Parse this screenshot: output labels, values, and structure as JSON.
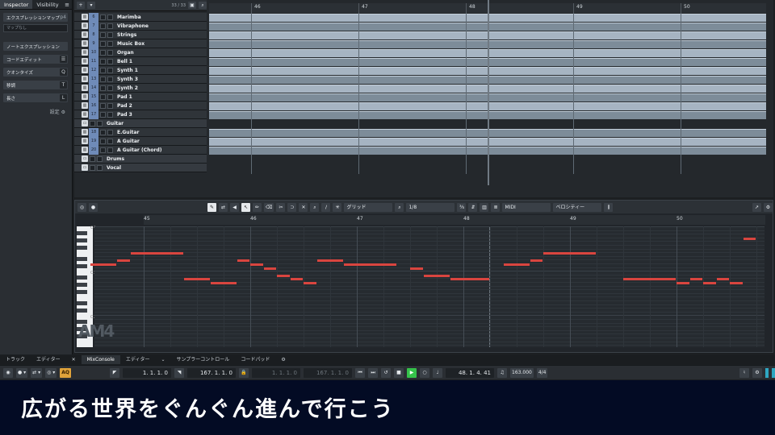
{
  "inspector": {
    "tabs": [
      {
        "label": "Inspector"
      },
      {
        "label": "Visibility"
      }
    ],
    "expression_map": {
      "label": "エクスプレッションマップ",
      "tag": "p4"
    },
    "expression_field": "マップなし",
    "sections": [
      {
        "label": "ノートエクスプレッション"
      },
      {
        "label": "コードエディット"
      },
      {
        "label": "クオンタイズ",
        "icon": "Q"
      },
      {
        "label": "移調",
        "icon": "T"
      },
      {
        "label": "長さ",
        "icon": "L"
      }
    ],
    "setting_label": "設定"
  },
  "project": {
    "counter": "33 / 33",
    "ruler_labels": [
      "46",
      "47",
      "48",
      "49",
      "50"
    ],
    "tracks": [
      {
        "num": "6",
        "name": "Marimba"
      },
      {
        "num": "7",
        "name": "Vibraphone"
      },
      {
        "num": "8",
        "name": "Strings"
      },
      {
        "num": "9",
        "name": "Music Box"
      },
      {
        "num": "10",
        "name": "Organ"
      },
      {
        "num": "11",
        "name": "Bell 1"
      },
      {
        "num": "12",
        "name": "Synth 1"
      },
      {
        "num": "13",
        "name": "Synth 3"
      },
      {
        "num": "14",
        "name": "Synth 2"
      },
      {
        "num": "15",
        "name": "Pad 1"
      },
      {
        "num": "16",
        "name": "Pad 2"
      },
      {
        "num": "17",
        "name": "Pad 3"
      },
      {
        "num": "",
        "name": "Guitar"
      },
      {
        "num": "18",
        "name": "E.Guitar"
      },
      {
        "num": "19",
        "name": "A Guitar"
      },
      {
        "num": "20",
        "name": "A Guitar (Chord)"
      },
      {
        "num": "",
        "name": "Drums"
      },
      {
        "num": "",
        "name": "Vocal"
      }
    ]
  },
  "editor": {
    "grid_label": "グリッド",
    "quantize_value": "1/8",
    "midi_label": "MIDI",
    "velocity_label": "ベロシティー",
    "ruler_labels": [
      "45",
      "46",
      "47",
      "48",
      "49",
      "50"
    ],
    "key_labels": [
      "C4",
      "C3",
      "C2"
    ],
    "watermark": "AM4"
  },
  "bottom_tabs": [
    {
      "label": "トラック"
    },
    {
      "label": "エディター"
    },
    {
      "label": "MixConsole"
    },
    {
      "label": "エディター"
    },
    {
      "label": "サンプラーコントロール"
    },
    {
      "label": "コードパッド"
    }
  ],
  "transport": {
    "aq": "AQ",
    "left_locator": "1. 1. 1.   0",
    "right_locator": "167. 1. 1.   0",
    "punch_in": "1. 1. 1.   0",
    "punch_out": "167. 1. 1.   0",
    "position": "48. 1. 4.  41",
    "tempo": "163.000",
    "signature": "4/4"
  },
  "subtitle": "広がる世界をぐんぐん進んで行こう",
  "colors": {
    "note": "#d9453f",
    "play": "#35c24a",
    "aq": "#e0a33a",
    "subtitle_bg": "#030b24"
  },
  "piano_notes": {
    "bars": [
      {
        "bar": 45,
        "x": 0.0
      },
      {
        "bar": 46,
        "x": 0.159
      },
      {
        "bar": 47,
        "x": 0.318
      },
      {
        "bar": 48,
        "x": 0.477
      },
      {
        "bar": 49,
        "x": 0.636
      },
      {
        "bar": 50,
        "x": 0.795
      }
    ],
    "notes": [
      {
        "start": -0.5,
        "len": 0.25,
        "pitch": 62
      },
      {
        "start": -0.25,
        "len": 0.125,
        "pitch": 63
      },
      {
        "start": -0.125,
        "len": 0.5,
        "pitch": 65
      },
      {
        "start": 0.375,
        "len": 0.25,
        "pitch": 58
      },
      {
        "start": 0.625,
        "len": 0.25,
        "pitch": 57
      },
      {
        "start": 0.875,
        "len": 0.125,
        "pitch": 63
      },
      {
        "start": 1.0,
        "len": 0.125,
        "pitch": 62
      },
      {
        "start": 1.125,
        "len": 0.125,
        "pitch": 61
      },
      {
        "start": 1.25,
        "len": 0.125,
        "pitch": 59
      },
      {
        "start": 1.375,
        "len": 0.125,
        "pitch": 58
      },
      {
        "start": 1.5,
        "len": 0.125,
        "pitch": 57
      },
      {
        "start": 1.625,
        "len": 0.25,
        "pitch": 63
      },
      {
        "start": 1.875,
        "len": 0.5,
        "pitch": 62
      },
      {
        "start": 2.5,
        "len": 0.125,
        "pitch": 61
      },
      {
        "start": 2.625,
        "len": 0.25,
        "pitch": 59
      },
      {
        "start": 2.875,
        "len": 0.375,
        "pitch": 58
      },
      {
        "start": 3.375,
        "len": 0.25,
        "pitch": 62
      },
      {
        "start": 3.625,
        "len": 0.125,
        "pitch": 63
      },
      {
        "start": 3.75,
        "len": 0.5,
        "pitch": 65
      },
      {
        "start": 4.5,
        "len": 0.5,
        "pitch": 58
      },
      {
        "start": 5.0,
        "len": 0.125,
        "pitch": 57
      },
      {
        "start": 5.125,
        "len": 0.125,
        "pitch": 58
      },
      {
        "start": 5.25,
        "len": 0.125,
        "pitch": 57
      },
      {
        "start": 5.375,
        "len": 0.125,
        "pitch": 58
      },
      {
        "start": 5.5,
        "len": 0.125,
        "pitch": 57
      },
      {
        "start": 5.625,
        "len": 0.125,
        "pitch": 69
      }
    ]
  }
}
